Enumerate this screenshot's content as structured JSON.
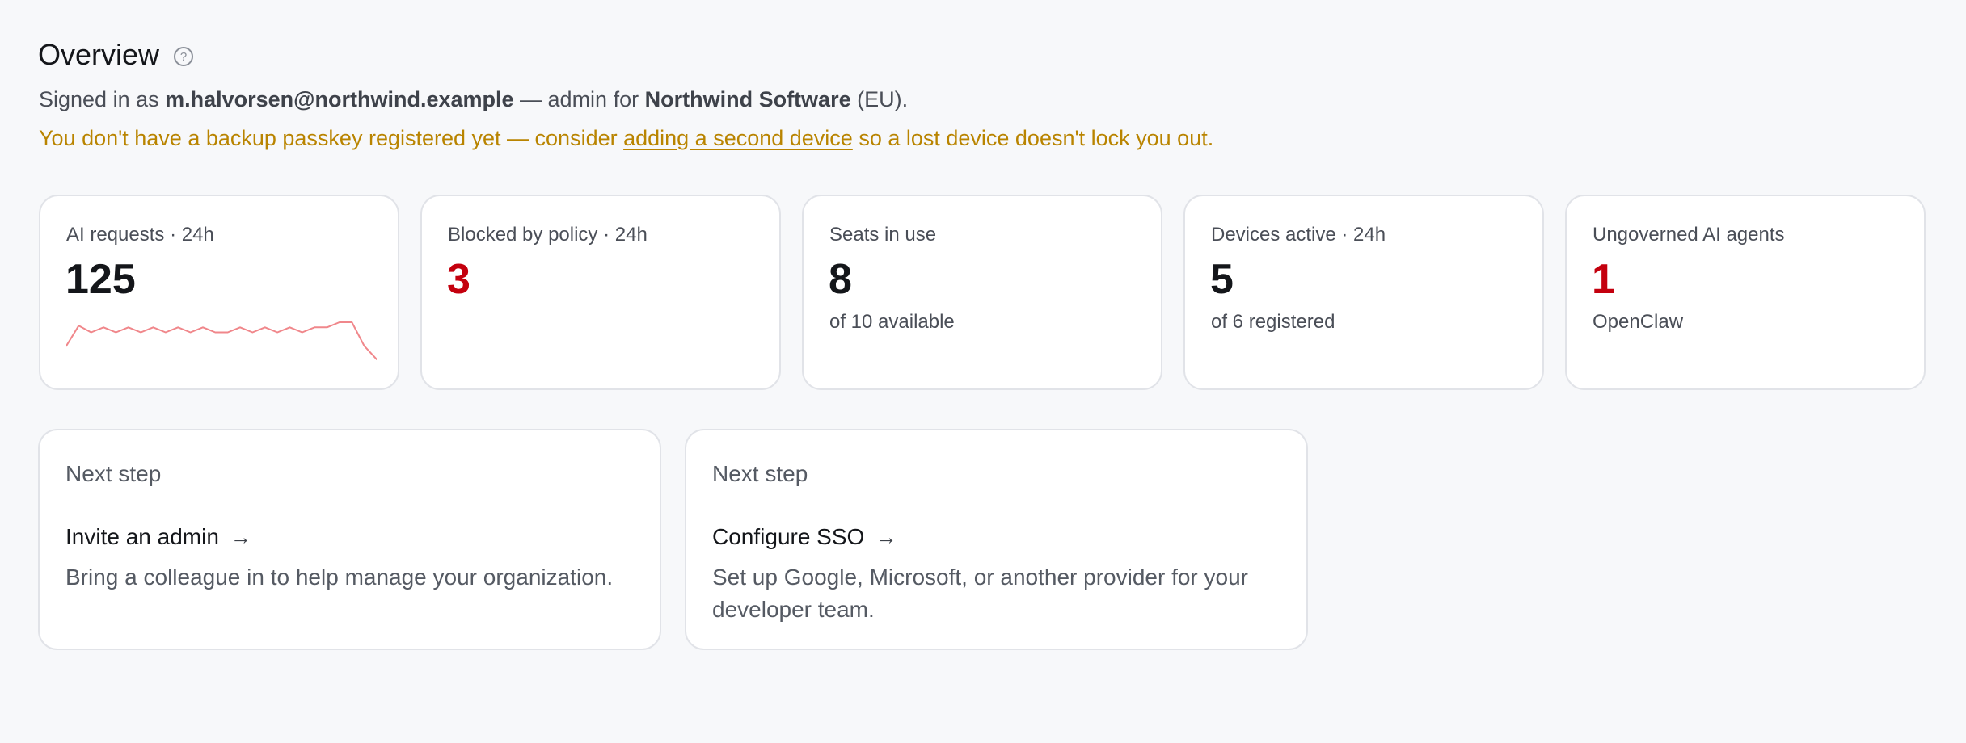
{
  "header": {
    "title": "Overview",
    "help_icon": "question-circle-icon"
  },
  "signed_in": {
    "prefix": "Signed in as ",
    "email": "m.halvorsen@northwind.example",
    "middle": " — admin for ",
    "org": "Northwind Software",
    "suffix": " (EU)."
  },
  "warning": {
    "prefix": "You don't have a backup passkey registered yet — consider ",
    "link": "adding a second device",
    "suffix": " so a lost device doesn't lock you out.",
    "color": "#b98400"
  },
  "stats": [
    {
      "label": "AI requests · 24h",
      "value": "125",
      "alert": false
    },
    {
      "label": "Blocked by policy · 24h",
      "value": "3",
      "alert": true
    },
    {
      "label": "Seats in use",
      "value": "8",
      "sub": "of 10 available",
      "alert": false
    },
    {
      "label": "Devices active · 24h",
      "value": "5",
      "sub": "of 6 registered",
      "alert": false
    },
    {
      "label": "Ungoverned AI agents",
      "value": "1",
      "sub": "OpenClaw",
      "alert": true
    }
  ],
  "sparkline": {
    "color": "#f0878b",
    "values": [
      2,
      8,
      6,
      7.5,
      6,
      7.5,
      6,
      7.5,
      6,
      7.5,
      6,
      7.5,
      6,
      6,
      7.5,
      6,
      7.5,
      6,
      7.5,
      6,
      7.5,
      7.5,
      9,
      9,
      2,
      -2
    ]
  },
  "next_steps": [
    {
      "label": "Next step",
      "link": "Invite an admin",
      "arrow_icon": "arrow-right-icon",
      "description": "Bring a colleague in to help manage your organization."
    },
    {
      "label": "Next step",
      "link": "Configure SSO",
      "arrow_icon": "arrow-right-icon",
      "description": "Set up Google, Microsoft, or another provider for your developer team."
    }
  ],
  "colors": {
    "alert": "#c4000e",
    "background": "#f7f8fa",
    "card_border": "#e1e3e8"
  }
}
